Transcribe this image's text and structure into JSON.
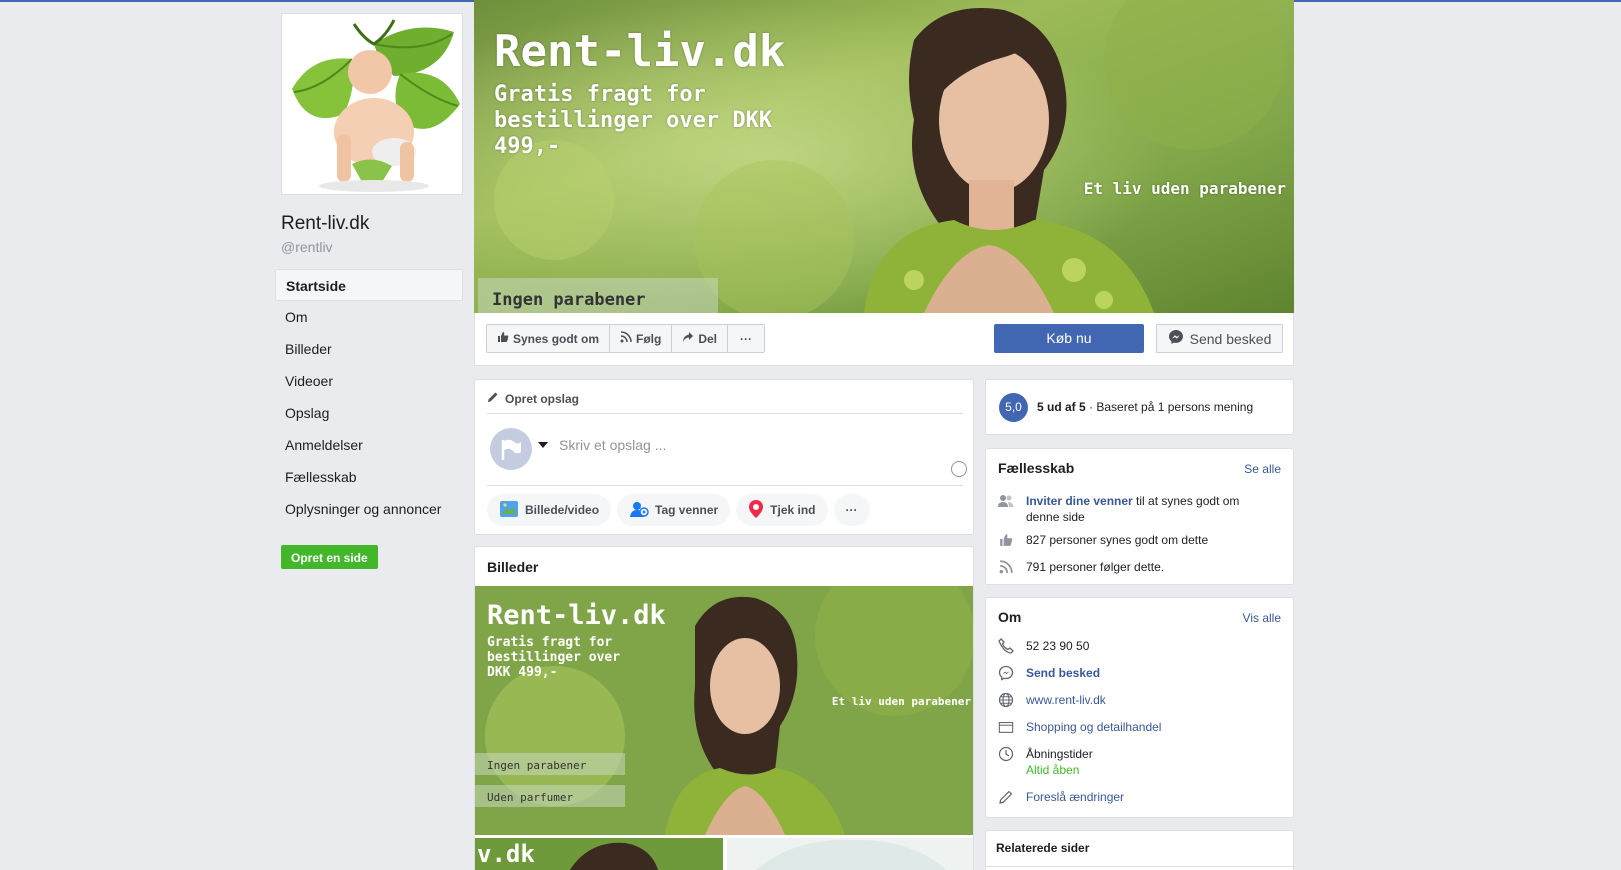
{
  "page": {
    "name": "Rent-liv.dk",
    "handle": "@rentliv"
  },
  "nav": [
    {
      "label": "Startside",
      "active": true
    },
    {
      "label": "Om"
    },
    {
      "label": "Billeder"
    },
    {
      "label": "Videoer"
    },
    {
      "label": "Opslag"
    },
    {
      "label": "Anmeldelser"
    },
    {
      "label": "Fællesskab"
    },
    {
      "label": "Oplysninger og annoncer"
    }
  ],
  "create_page_label": "Opret en side",
  "cover": {
    "title": "Rent-liv.dk",
    "subtitle": "Gratis fragt for bestillinger over DKK 499,-",
    "tagline": "Et liv uden parabener",
    "badge": "Ingen parabener"
  },
  "actions": {
    "like": "Synes godt om",
    "follow": "Følg",
    "share": "Del",
    "more": "···",
    "buy": "Køb nu",
    "message": "Send besked"
  },
  "composer": {
    "header": "Opret opslag",
    "placeholder": "Skriv et opslag ...",
    "photo_video": "Billede/video",
    "tag_friends": "Tag venner",
    "check_in": "Tjek ind",
    "more": "···"
  },
  "photos": {
    "title": "Billeder",
    "main": {
      "title": "Rent-liv.dk",
      "subtitle": "Gratis fragt for bestillinger over DKK 499,-",
      "tagline": "Et liv uden parabener",
      "badge1": "Ingen parabener",
      "badge2": "Uden parfumer"
    },
    "thumb_text": "v.dk"
  },
  "rating": {
    "score": "5,0",
    "bold": "5 ud af 5",
    "rest": " · Baseret på 1 persons mening"
  },
  "community": {
    "title": "Fællesskab",
    "see_all": "Se alle",
    "invite_link": "Inviter dine venner",
    "invite_rest": " til at synes godt om denne side",
    "likes": "827 personer synes godt om dette",
    "follows": "791 personer følger dette."
  },
  "about": {
    "title": "Om",
    "see_all": "Vis alle",
    "phone": "52 23 90 50",
    "message": "Send besked",
    "website": "www.rent-liv.dk",
    "category": "Shopping og detailhandel",
    "hours_label": "Åbningstider",
    "hours_value": "Altid åben",
    "suggest": "Foreslå ændringer"
  },
  "related": {
    "title": "Relaterede sider"
  },
  "colors": {
    "fb_blue": "#4267b2",
    "link": "#385898",
    "green": "#42b72a",
    "background": "#e9ebee"
  }
}
